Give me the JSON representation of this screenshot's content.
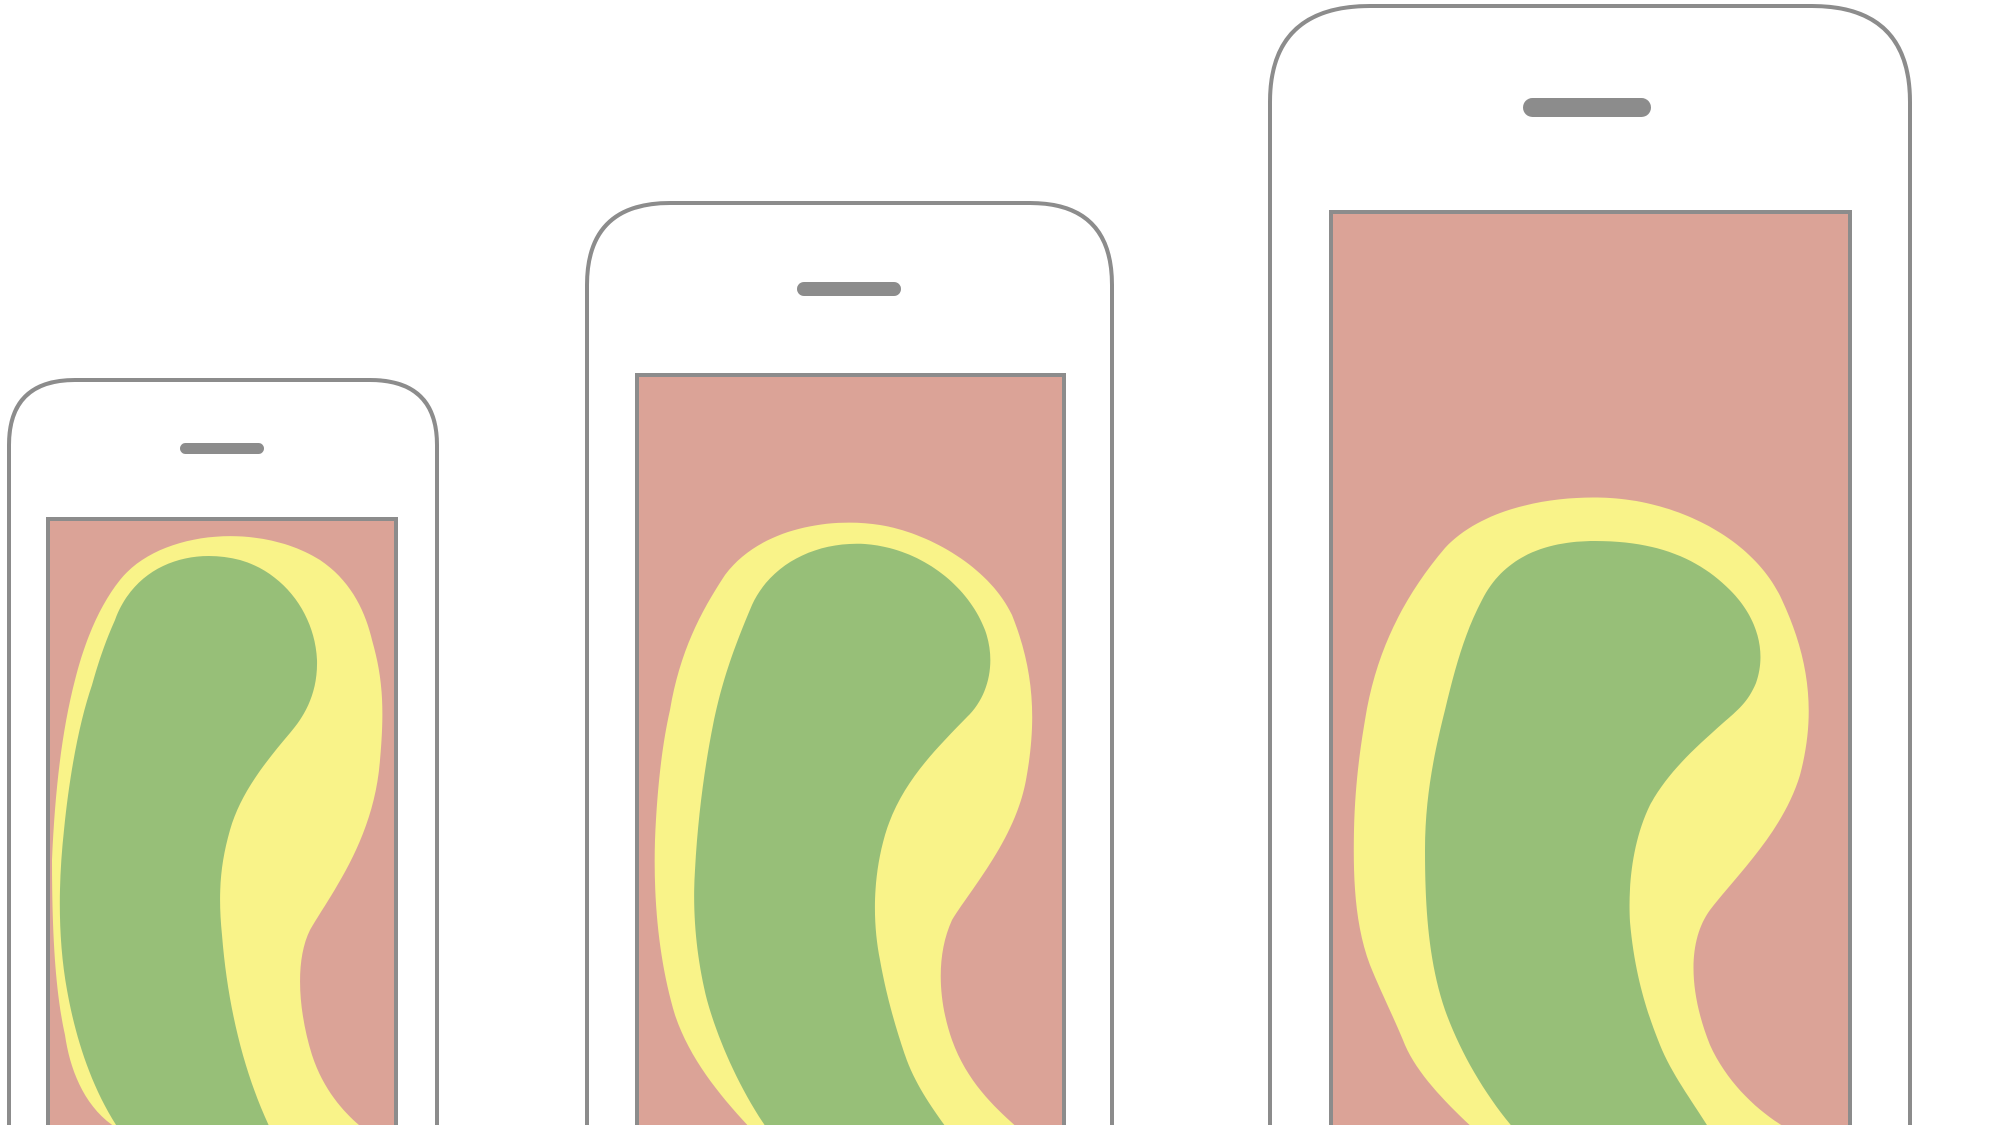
{
  "diagram": {
    "colors": {
      "background": "#ffffff",
      "device_outline": "#8c8c8c",
      "screen_fill": "#dba397",
      "outer_blob_fill": "#f9f389",
      "inner_blob_fill": "#97bf78"
    },
    "devices": [
      {
        "name": "small-phone",
        "parts": [
          "device-body",
          "speaker-slot",
          "screen",
          "outer-blob",
          "inner-blob"
        ]
      },
      {
        "name": "medium-phone",
        "parts": [
          "device-body",
          "speaker-slot",
          "screen",
          "outer-blob",
          "inner-blob"
        ]
      },
      {
        "name": "large-phone",
        "parts": [
          "device-body",
          "speaker-slot",
          "screen",
          "outer-blob",
          "inner-blob"
        ]
      }
    ]
  }
}
